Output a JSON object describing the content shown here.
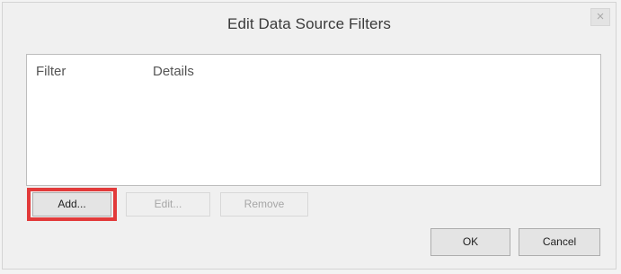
{
  "dialog": {
    "title": "Edit Data Source Filters",
    "close_label": "×"
  },
  "table": {
    "columns": [
      "Filter",
      "Details"
    ],
    "rows": []
  },
  "buttons": {
    "add": "Add...",
    "edit": "Edit...",
    "remove": "Remove",
    "ok": "OK",
    "cancel": "Cancel"
  },
  "highlight": {
    "target": "add-button",
    "color": "#e23a3a"
  }
}
